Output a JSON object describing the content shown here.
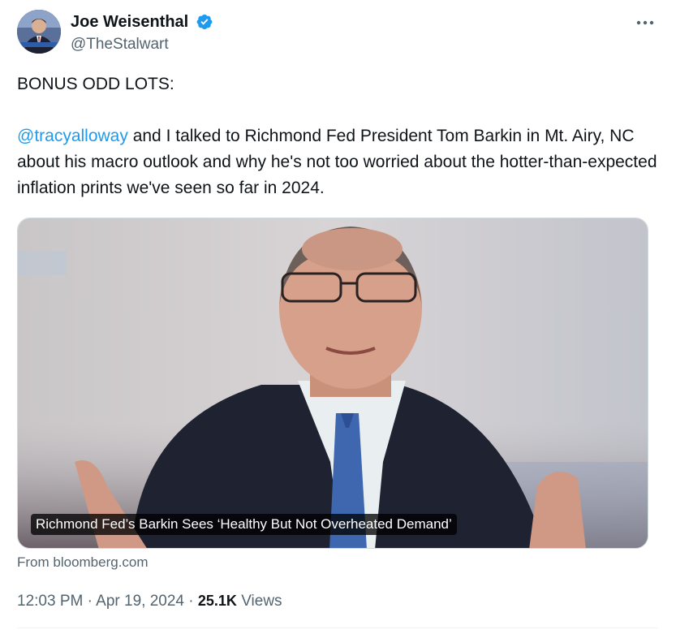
{
  "author": {
    "display_name": "Joe Weisenthal",
    "handle": "@TheStalwart",
    "verified": true,
    "avatar_icon": "profile-photo",
    "verified_color": "#1d9bf0"
  },
  "menu": {
    "icon": "more-horizontal-icon"
  },
  "tweet": {
    "line1": "BONUS ODD LOTS:",
    "mention": "@tracyalloway",
    "body": " and I talked to Richmond Fed President Tom Barkin in Mt. Airy, NC about his macro outlook and why he's not too worried about the hotter-than-expected inflation prints we've seen so far in 2024.",
    "mention_color": "#1d9bf0"
  },
  "card": {
    "title": "Richmond Fed’s Barkin Sees ‘Healthy But Not Overheated Demand’",
    "from": "From bloomberg.com"
  },
  "meta": {
    "time": "12:03 PM",
    "separator": "·",
    "date": "Apr 19, 2024",
    "views_count": "25.1K",
    "views_label": "Views"
  }
}
